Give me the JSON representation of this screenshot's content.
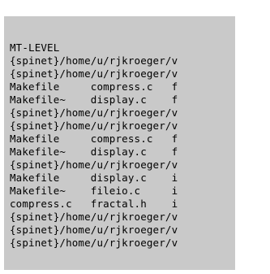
{
  "terminal": {
    "lines": [
      "MT-LEVEL",
      "{spinet}/home/u/rjkroeger/v",
      "{spinet}/home/u/rjkroeger/v",
      "Makefile     compress.c   f",
      "Makefile~    display.c    f",
      "{spinet}/home/u/rjkroeger/v",
      "{spinet}/home/u/rjkroeger/v",
      "Makefile     compress.c   f",
      "Makefile~    display.c    f",
      "{spinet}/home/u/rjkroeger/v",
      "Makefile     display.c    i",
      "Makefile~    fileio.c     i",
      "compress.c   fractal.h    i",
      "{spinet}/home/u/rjkroeger/v",
      "{spinet}/home/u/rjkroeger/v",
      "{spinet}/home/u/rjkroeger/v"
    ]
  }
}
